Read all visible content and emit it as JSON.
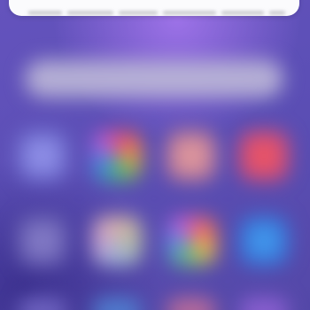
{
  "wallpaper": {
    "colors": [
      "#6453bd",
      "#5448a8",
      "#a878f0"
    ]
  },
  "search_bar": {
    "color": "#b8b3d6"
  },
  "app_grid": {
    "rows": [
      [
        {
          "icon": "app-icon-lavender",
          "color": "#8383df"
        },
        {
          "icon": "app-icon-multicolor-swirl",
          "color": "#5f8fc3"
        },
        {
          "icon": "app-icon-salmon",
          "color": "#cf8b9a"
        },
        {
          "icon": "app-icon-red",
          "color": "#e2506e"
        }
      ],
      [
        {
          "icon": "app-icon-muted-purple",
          "color": "#7b71c0"
        },
        {
          "icon": "app-icon-pastel-multicolor",
          "color": "#a49bc0"
        },
        {
          "icon": "app-icon-colorful-pinwheel",
          "color": "#c9768a"
        },
        {
          "icon": "app-icon-blue",
          "color": "#3e8de0"
        }
      ]
    ]
  },
  "notification": {
    "background": "#fbfbfd"
  }
}
